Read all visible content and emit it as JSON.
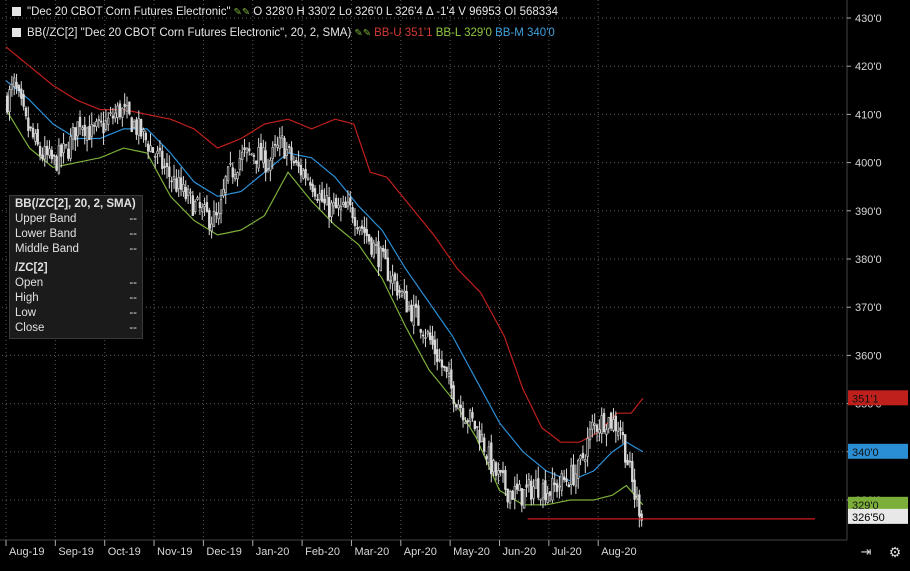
{
  "header": {
    "line1": {
      "symbol": "\"Dec 20 CBOT Corn Futures Electronic\"",
      "quote": "O 328'0  H 330'2  Lo 326'0  L 326'4  Δ -1'4  V 96953  OI 568334"
    },
    "line2": {
      "study": "BB(/ZC[2] \"Dec 20 CBOT Corn Futures Electronic\", 20, 2, SMA)",
      "bb_u": "BB-U 351'1",
      "bb_l": "BB-L 329'0",
      "bb_m": "BB-M 340'0"
    }
  },
  "legend": {
    "title": "BB(/ZC[2], 20, 2, SMA)",
    "rows": [
      {
        "label": "Upper Band",
        "value": "--"
      },
      {
        "label": "Lower Band",
        "value": "--"
      },
      {
        "label": "Middle Band",
        "value": "--"
      }
    ],
    "title2": "/ZC[2]",
    "rows2": [
      {
        "label": "Open",
        "value": "--"
      },
      {
        "label": "High",
        "value": "--"
      },
      {
        "label": "Low",
        "value": "--"
      },
      {
        "label": "Close",
        "value": "--"
      }
    ]
  },
  "colors": {
    "upper": "#c0201c",
    "lower": "#7cae3a",
    "middle": "#2b8fd6",
    "candle_up": "#2e2e2e",
    "candle_wick": "#d8d8d8",
    "support_line": "#d11a1a",
    "grid": "#5a5a5a"
  },
  "chart_data": {
    "type": "candlestick",
    "ylim": [
      322,
      432
    ],
    "yticks": [
      "430'0",
      "420'0",
      "410'0",
      "400'0",
      "390'0",
      "380'0",
      "370'0",
      "360'0",
      "350'0",
      "340'0",
      "330'0"
    ],
    "ytick_values": [
      430,
      420,
      410,
      400,
      390,
      380,
      370,
      360,
      350,
      340,
      330
    ],
    "xticks": [
      "Aug-19",
      "Sep-19",
      "Oct-19",
      "Nov-19",
      "Dec-19",
      "Jan-20",
      "Feb-20",
      "Mar-20",
      "Apr-20",
      "May-20",
      "Jun-20",
      "Jul-20",
      "Aug-20"
    ],
    "bars_per_month": 21,
    "close_anchors": [
      [
        0,
        413
      ],
      [
        3,
        416
      ],
      [
        8,
        408
      ],
      [
        14,
        402
      ],
      [
        20,
        400
      ],
      [
        26,
        403
      ],
      [
        31,
        409
      ],
      [
        36,
        406
      ],
      [
        42,
        408
      ],
      [
        48,
        411
      ],
      [
        54,
        408
      ],
      [
        60,
        404
      ],
      [
        68,
        398
      ],
      [
        76,
        393
      ],
      [
        84,
        389
      ],
      [
        90,
        388
      ],
      [
        93,
        396
      ],
      [
        99,
        401
      ],
      [
        105,
        402
      ],
      [
        111,
        400
      ],
      [
        117,
        404
      ],
      [
        123,
        399
      ],
      [
        129,
        397
      ],
      [
        135,
        391
      ],
      [
        141,
        390
      ],
      [
        147,
        390
      ],
      [
        153,
        385
      ],
      [
        159,
        380
      ],
      [
        165,
        375
      ],
      [
        171,
        370
      ],
      [
        177,
        366
      ],
      [
        183,
        360
      ],
      [
        189,
        353
      ],
      [
        195,
        348
      ],
      [
        201,
        344
      ],
      [
        207,
        336
      ],
      [
        213,
        332
      ],
      [
        219,
        331
      ],
      [
        225,
        333
      ],
      [
        231,
        332
      ],
      [
        237,
        334
      ],
      [
        243,
        336
      ],
      [
        249,
        345
      ],
      [
        255,
        347
      ],
      [
        261,
        345
      ],
      [
        264,
        338
      ],
      [
        267,
        331
      ],
      [
        270,
        327.5
      ]
    ],
    "upper_band_anchors": [
      [
        0,
        424
      ],
      [
        10,
        420
      ],
      [
        20,
        416
      ],
      [
        30,
        413
      ],
      [
        40,
        411
      ],
      [
        50,
        411
      ],
      [
        60,
        410
      ],
      [
        70,
        409
      ],
      [
        80,
        407
      ],
      [
        90,
        403
      ],
      [
        100,
        405
      ],
      [
        110,
        408
      ],
      [
        120,
        409
      ],
      [
        130,
        407
      ],
      [
        140,
        409
      ],
      [
        148,
        408
      ],
      [
        155,
        398
      ],
      [
        162,
        397
      ],
      [
        172,
        391
      ],
      [
        182,
        385
      ],
      [
        192,
        378
      ],
      [
        202,
        373
      ],
      [
        212,
        364
      ],
      [
        220,
        353
      ],
      [
        228,
        345
      ],
      [
        236,
        342
      ],
      [
        244,
        342
      ],
      [
        252,
        344
      ],
      [
        260,
        348
      ],
      [
        266,
        348
      ],
      [
        271,
        351.1
      ]
    ],
    "middle_band_anchors": [
      [
        0,
        417
      ],
      [
        10,
        413
      ],
      [
        20,
        408
      ],
      [
        30,
        405
      ],
      [
        40,
        405
      ],
      [
        50,
        407
      ],
      [
        60,
        407
      ],
      [
        70,
        402
      ],
      [
        80,
        396
      ],
      [
        90,
        393
      ],
      [
        100,
        394
      ],
      [
        110,
        398
      ],
      [
        120,
        402
      ],
      [
        130,
        401
      ],
      [
        140,
        397
      ],
      [
        150,
        391
      ],
      [
        160,
        386
      ],
      [
        170,
        378
      ],
      [
        180,
        371
      ],
      [
        190,
        364
      ],
      [
        200,
        355
      ],
      [
        210,
        346
      ],
      [
        220,
        340
      ],
      [
        230,
        336
      ],
      [
        240,
        334
      ],
      [
        250,
        336
      ],
      [
        258,
        340
      ],
      [
        264,
        342
      ],
      [
        271,
        340
      ]
    ],
    "lower_band_anchors": [
      [
        0,
        411
      ],
      [
        10,
        403
      ],
      [
        20,
        399
      ],
      [
        30,
        400
      ],
      [
        40,
        401
      ],
      [
        50,
        403
      ],
      [
        60,
        402
      ],
      [
        70,
        393
      ],
      [
        80,
        388
      ],
      [
        90,
        385
      ],
      [
        100,
        386
      ],
      [
        110,
        389
      ],
      [
        120,
        398
      ],
      [
        130,
        392
      ],
      [
        140,
        387
      ],
      [
        150,
        383
      ],
      [
        160,
        376
      ],
      [
        170,
        366
      ],
      [
        180,
        357
      ],
      [
        190,
        351
      ],
      [
        200,
        343
      ],
      [
        210,
        332
      ],
      [
        220,
        329
      ],
      [
        230,
        329
      ],
      [
        240,
        330
      ],
      [
        250,
        330
      ],
      [
        258,
        331
      ],
      [
        264,
        333
      ],
      [
        271,
        329
      ]
    ],
    "price_labels": [
      {
        "text": "351'1",
        "value": 351.1,
        "color": "#c0201c"
      },
      {
        "text": "340'0",
        "value": 340,
        "color": "#2b8fd6"
      },
      {
        "text": "329'0",
        "value": 329,
        "color": "#7cae3a"
      },
      {
        "text": "326'50",
        "value": 326.5,
        "color": "#e8e8e8"
      }
    ],
    "support_level": 326.5,
    "support_start_bar": 222
  }
}
